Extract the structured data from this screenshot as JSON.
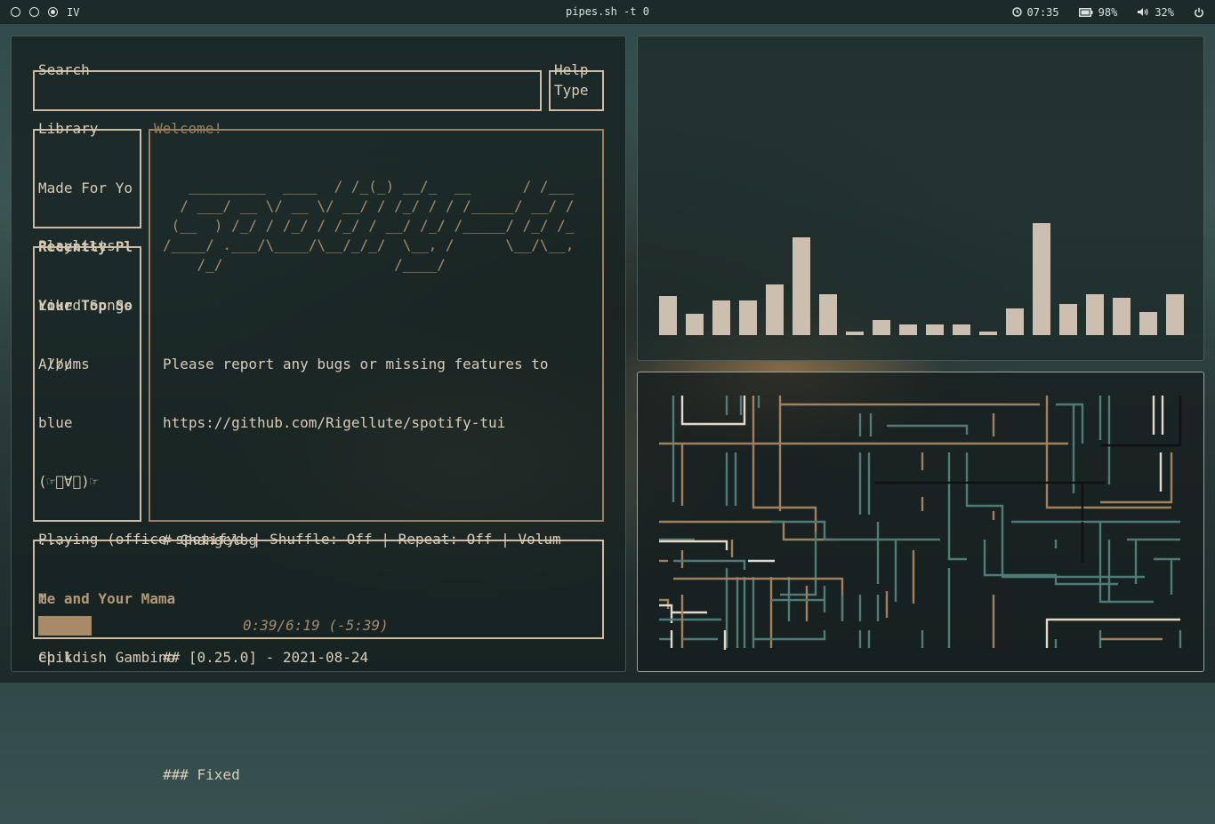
{
  "topbar": {
    "workspace_label": "IV",
    "window_title": "pipes.sh -t 0",
    "clock": "07:35",
    "battery": "98%",
    "volume": "32%"
  },
  "spotify": {
    "search_title": "Search",
    "search_value": "",
    "help_title": "Help",
    "help_text": "Type",
    "library_title": "Library",
    "library_items": [
      "Made For Yo",
      "Recently Pl",
      "Liked Songs",
      "Albums"
    ],
    "playlists_title": "Playlists",
    "playlist_items": [
      "Your Top So",
      " ///",
      "blue",
      "(☞ﾟ∀ﾟ)☞",
      "...",
      "t",
      "epik"
    ],
    "welcome_title": "Welcome!",
    "ascii_banner": "   _________  ____  / /_(_) __/_  __      / /___\n  / ___/ __ \\/ __ \\/ __/ / /_/ / / /_____/ __/ /\n (__  ) /_/ / /_/ / /_/ / __/ /_/ /_____/ /_/ /_\n/____/ .___/\\____/\\__/_/_/  \\__, /      \\__/\\__,\n    /_/                    /____/",
    "welcome_lines": [
      "Please report any bugs or missing features to",
      "https://github.com/Rigellute/spotify-tui",
      "",
      "# Changelog",
      "",
      "## [0.25.0] - 2021-08-24",
      "",
      "### Fixed"
    ],
    "playing_title": "Playing (office-spotifyd | Shuffle: Off | Repeat: Off   | Volum",
    "track_name": "Me and Your Mama",
    "artist_name": "Childish Gambino",
    "progress_time": "0:39/6:19 (-5:39)",
    "progress_fraction": 0.103
  },
  "visualizer": {
    "bar_values": [
      0.4,
      0.22,
      0.35,
      0.35,
      0.52,
      1.0,
      0.42,
      0.04,
      0.15,
      0.11,
      0.11,
      0.11,
      0.04,
      0.27,
      1.15,
      0.32,
      0.42,
      0.38,
      0.24,
      0.42
    ],
    "bar_color": "#cdbfb0"
  },
  "colors": {
    "accent_tan": "#cdbba3",
    "accent_orange": "#9d7f5f",
    "pipe_teal": "#4e7d78",
    "pipe_brown": "#a2805c",
    "pipe_cream": "#e3d9ca"
  }
}
